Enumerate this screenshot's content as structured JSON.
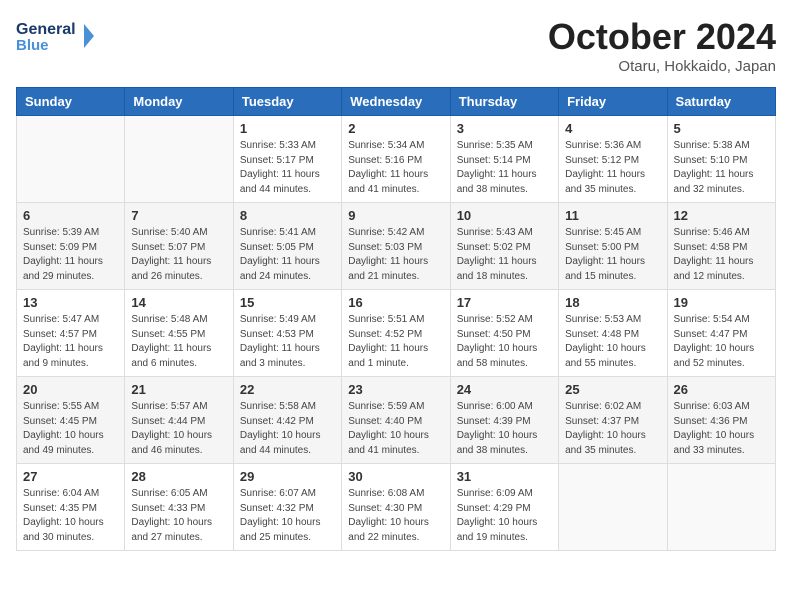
{
  "header": {
    "logo_line1": "General",
    "logo_line2": "Blue",
    "title": "October 2024",
    "subtitle": "Otaru, Hokkaido, Japan"
  },
  "weekdays": [
    "Sunday",
    "Monday",
    "Tuesday",
    "Wednesday",
    "Thursday",
    "Friday",
    "Saturday"
  ],
  "weeks": [
    [
      {
        "day": "",
        "sunrise": "",
        "sunset": "",
        "daylight": ""
      },
      {
        "day": "",
        "sunrise": "",
        "sunset": "",
        "daylight": ""
      },
      {
        "day": "1",
        "sunrise": "Sunrise: 5:33 AM",
        "sunset": "Sunset: 5:17 PM",
        "daylight": "Daylight: 11 hours and 44 minutes."
      },
      {
        "day": "2",
        "sunrise": "Sunrise: 5:34 AM",
        "sunset": "Sunset: 5:16 PM",
        "daylight": "Daylight: 11 hours and 41 minutes."
      },
      {
        "day": "3",
        "sunrise": "Sunrise: 5:35 AM",
        "sunset": "Sunset: 5:14 PM",
        "daylight": "Daylight: 11 hours and 38 minutes."
      },
      {
        "day": "4",
        "sunrise": "Sunrise: 5:36 AM",
        "sunset": "Sunset: 5:12 PM",
        "daylight": "Daylight: 11 hours and 35 minutes."
      },
      {
        "day": "5",
        "sunrise": "Sunrise: 5:38 AM",
        "sunset": "Sunset: 5:10 PM",
        "daylight": "Daylight: 11 hours and 32 minutes."
      }
    ],
    [
      {
        "day": "6",
        "sunrise": "Sunrise: 5:39 AM",
        "sunset": "Sunset: 5:09 PM",
        "daylight": "Daylight: 11 hours and 29 minutes."
      },
      {
        "day": "7",
        "sunrise": "Sunrise: 5:40 AM",
        "sunset": "Sunset: 5:07 PM",
        "daylight": "Daylight: 11 hours and 26 minutes."
      },
      {
        "day": "8",
        "sunrise": "Sunrise: 5:41 AM",
        "sunset": "Sunset: 5:05 PM",
        "daylight": "Daylight: 11 hours and 24 minutes."
      },
      {
        "day": "9",
        "sunrise": "Sunrise: 5:42 AM",
        "sunset": "Sunset: 5:03 PM",
        "daylight": "Daylight: 11 hours and 21 minutes."
      },
      {
        "day": "10",
        "sunrise": "Sunrise: 5:43 AM",
        "sunset": "Sunset: 5:02 PM",
        "daylight": "Daylight: 11 hours and 18 minutes."
      },
      {
        "day": "11",
        "sunrise": "Sunrise: 5:45 AM",
        "sunset": "Sunset: 5:00 PM",
        "daylight": "Daylight: 11 hours and 15 minutes."
      },
      {
        "day": "12",
        "sunrise": "Sunrise: 5:46 AM",
        "sunset": "Sunset: 4:58 PM",
        "daylight": "Daylight: 11 hours and 12 minutes."
      }
    ],
    [
      {
        "day": "13",
        "sunrise": "Sunrise: 5:47 AM",
        "sunset": "Sunset: 4:57 PM",
        "daylight": "Daylight: 11 hours and 9 minutes."
      },
      {
        "day": "14",
        "sunrise": "Sunrise: 5:48 AM",
        "sunset": "Sunset: 4:55 PM",
        "daylight": "Daylight: 11 hours and 6 minutes."
      },
      {
        "day": "15",
        "sunrise": "Sunrise: 5:49 AM",
        "sunset": "Sunset: 4:53 PM",
        "daylight": "Daylight: 11 hours and 3 minutes."
      },
      {
        "day": "16",
        "sunrise": "Sunrise: 5:51 AM",
        "sunset": "Sunset: 4:52 PM",
        "daylight": "Daylight: 11 hours and 1 minute."
      },
      {
        "day": "17",
        "sunrise": "Sunrise: 5:52 AM",
        "sunset": "Sunset: 4:50 PM",
        "daylight": "Daylight: 10 hours and 58 minutes."
      },
      {
        "day": "18",
        "sunrise": "Sunrise: 5:53 AM",
        "sunset": "Sunset: 4:48 PM",
        "daylight": "Daylight: 10 hours and 55 minutes."
      },
      {
        "day": "19",
        "sunrise": "Sunrise: 5:54 AM",
        "sunset": "Sunset: 4:47 PM",
        "daylight": "Daylight: 10 hours and 52 minutes."
      }
    ],
    [
      {
        "day": "20",
        "sunrise": "Sunrise: 5:55 AM",
        "sunset": "Sunset: 4:45 PM",
        "daylight": "Daylight: 10 hours and 49 minutes."
      },
      {
        "day": "21",
        "sunrise": "Sunrise: 5:57 AM",
        "sunset": "Sunset: 4:44 PM",
        "daylight": "Daylight: 10 hours and 46 minutes."
      },
      {
        "day": "22",
        "sunrise": "Sunrise: 5:58 AM",
        "sunset": "Sunset: 4:42 PM",
        "daylight": "Daylight: 10 hours and 44 minutes."
      },
      {
        "day": "23",
        "sunrise": "Sunrise: 5:59 AM",
        "sunset": "Sunset: 4:40 PM",
        "daylight": "Daylight: 10 hours and 41 minutes."
      },
      {
        "day": "24",
        "sunrise": "Sunrise: 6:00 AM",
        "sunset": "Sunset: 4:39 PM",
        "daylight": "Daylight: 10 hours and 38 minutes."
      },
      {
        "day": "25",
        "sunrise": "Sunrise: 6:02 AM",
        "sunset": "Sunset: 4:37 PM",
        "daylight": "Daylight: 10 hours and 35 minutes."
      },
      {
        "day": "26",
        "sunrise": "Sunrise: 6:03 AM",
        "sunset": "Sunset: 4:36 PM",
        "daylight": "Daylight: 10 hours and 33 minutes."
      }
    ],
    [
      {
        "day": "27",
        "sunrise": "Sunrise: 6:04 AM",
        "sunset": "Sunset: 4:35 PM",
        "daylight": "Daylight: 10 hours and 30 minutes."
      },
      {
        "day": "28",
        "sunrise": "Sunrise: 6:05 AM",
        "sunset": "Sunset: 4:33 PM",
        "daylight": "Daylight: 10 hours and 27 minutes."
      },
      {
        "day": "29",
        "sunrise": "Sunrise: 6:07 AM",
        "sunset": "Sunset: 4:32 PM",
        "daylight": "Daylight: 10 hours and 25 minutes."
      },
      {
        "day": "30",
        "sunrise": "Sunrise: 6:08 AM",
        "sunset": "Sunset: 4:30 PM",
        "daylight": "Daylight: 10 hours and 22 minutes."
      },
      {
        "day": "31",
        "sunrise": "Sunrise: 6:09 AM",
        "sunset": "Sunset: 4:29 PM",
        "daylight": "Daylight: 10 hours and 19 minutes."
      },
      {
        "day": "",
        "sunrise": "",
        "sunset": "",
        "daylight": ""
      },
      {
        "day": "",
        "sunrise": "",
        "sunset": "",
        "daylight": ""
      }
    ]
  ]
}
